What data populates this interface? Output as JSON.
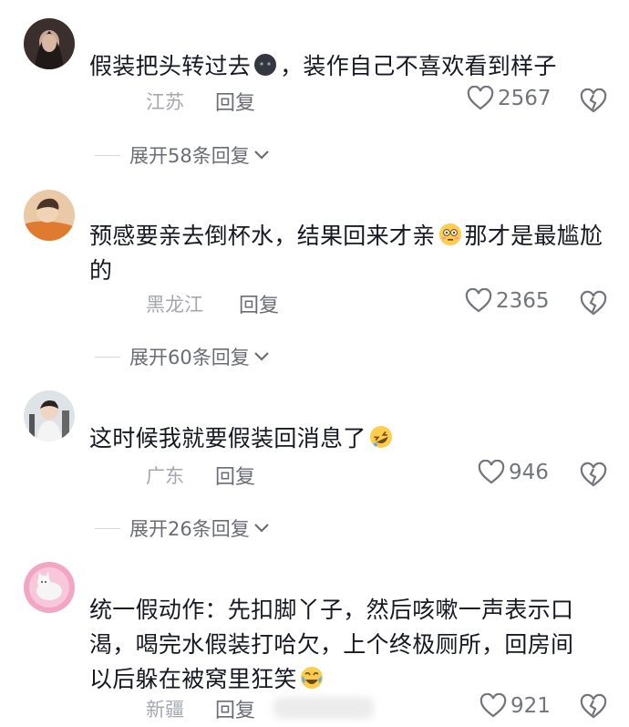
{
  "comments": [
    {
      "text_a": "假装把头转过去",
      "text_b": "，装作自己不喜欢看到样子",
      "emoji": "dark-face-emoji",
      "location": "江苏",
      "reply_label": "回复",
      "likes": "2567",
      "expand_label": "展开58条回复"
    },
    {
      "text_a": "预感要亲去倒杯水，结果回来才亲",
      "text_b": "那才是最尴尬的",
      "emoji": "flushed-face-emoji",
      "location": "黑龙江",
      "reply_label": "回复",
      "likes": "2365",
      "expand_label": "展开60条回复"
    },
    {
      "text_a": "这时候我就要假装回消息了",
      "text_b": "",
      "emoji": "rofl-emoji",
      "location": "广东",
      "reply_label": "回复",
      "likes": "946",
      "expand_label": "展开26条回复"
    },
    {
      "text_a": "统一假动作：先扣脚丫子，然后咳嗽一声表示口渴，喝完水假装打哈欠，上个终极厕所，回房间以后躲在被窝里狂笑",
      "text_b": "",
      "emoji": "laughing-crying-emoji",
      "location": "新疆",
      "reply_label": "回复",
      "likes": "921"
    }
  ],
  "colors": {
    "text": "#161823",
    "meta": "#a6a8ae",
    "secondary": "#6b6d74"
  }
}
